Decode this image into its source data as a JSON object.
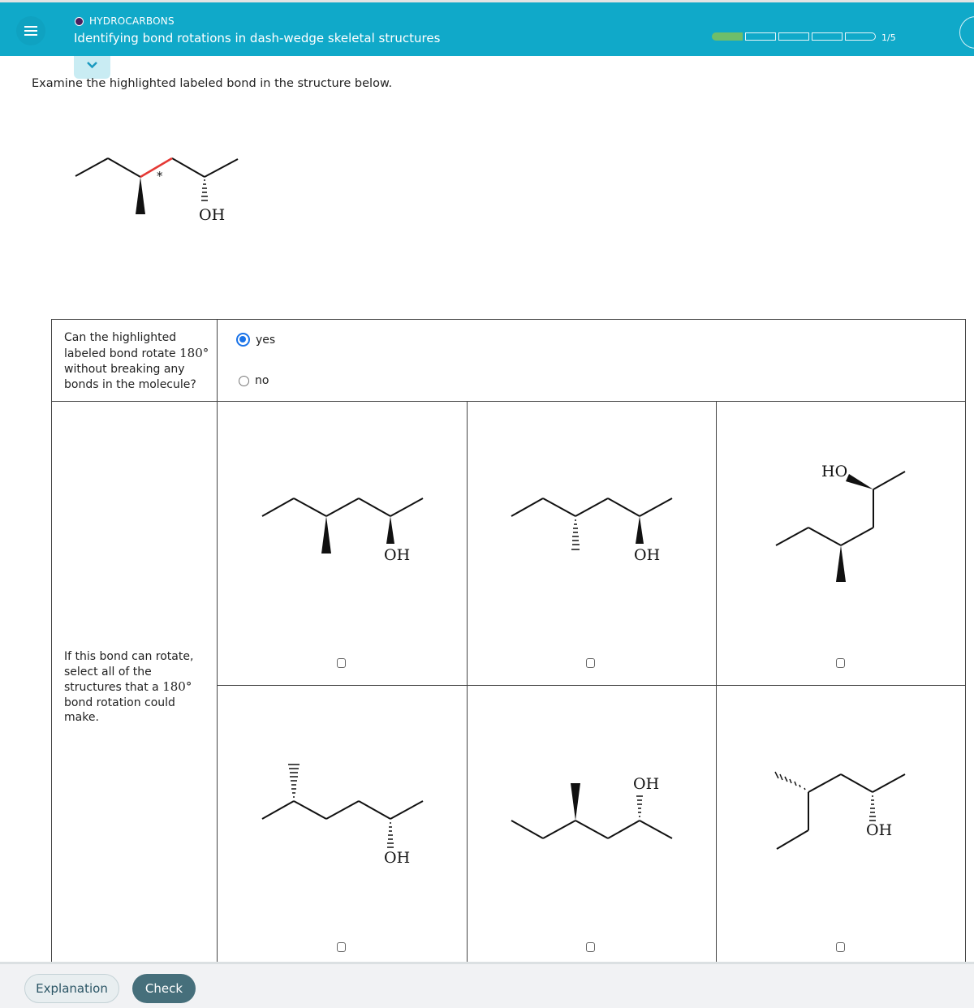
{
  "header": {
    "topic": "HYDROCARBONS",
    "title": "Identifying bond rotations in dash-wedge skeletal structures",
    "progress": {
      "completed": 1,
      "total": 5,
      "label": "1/5"
    },
    "colors": {
      "bar": "#10a9c9",
      "progress_done": "#6fbe6a",
      "topic_dot": "#4a1e5e"
    }
  },
  "prompt": "Examine the highlighted labeled bond in the structure below.",
  "main_structure": {
    "highlight_color": "#e53935",
    "marker": "*",
    "oh_label": "OH"
  },
  "question1": {
    "text_before": "Can the highlighted labeled bond rotate ",
    "angle": "180°",
    "text_after": " without breaking any bonds in the molecule?",
    "options": [
      {
        "label": "yes",
        "selected": true
      },
      {
        "label": "no",
        "selected": false
      }
    ]
  },
  "question2": {
    "text_before": "If this bond can rotate, select all of the structures that a ",
    "angle": "180°",
    "text_after": " bond rotation could make."
  },
  "choices": [
    {
      "id": "a",
      "label": "OH",
      "checked": false
    },
    {
      "id": "b",
      "label": "OH",
      "checked": false
    },
    {
      "id": "c",
      "label": "HO",
      "checked": false
    },
    {
      "id": "d",
      "label": "OH",
      "checked": false
    },
    {
      "id": "e",
      "label": "OH",
      "checked": false
    },
    {
      "id": "f",
      "label": "OH",
      "checked": false
    }
  ],
  "footer": {
    "explanation_label": "Explanation",
    "check_label": "Check"
  }
}
